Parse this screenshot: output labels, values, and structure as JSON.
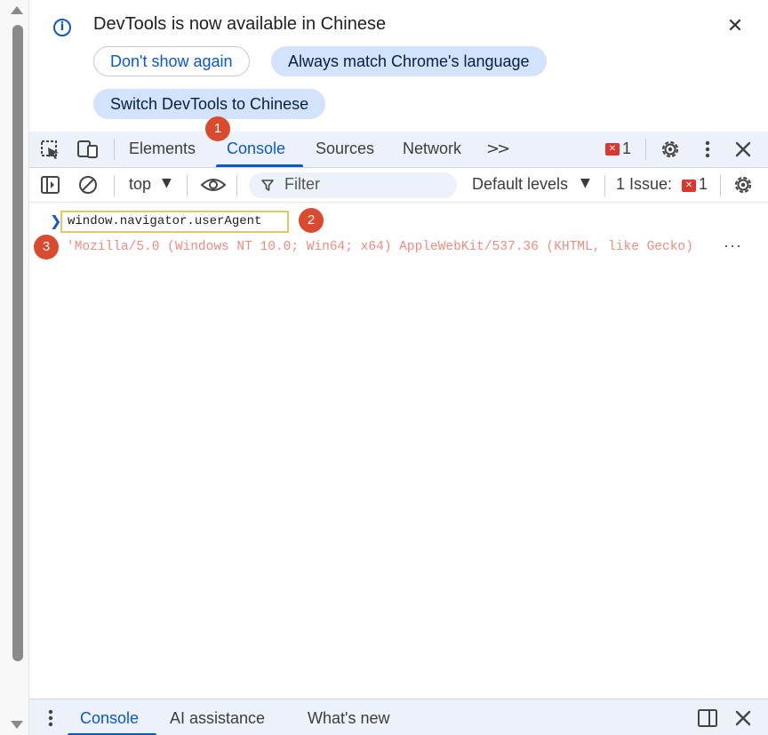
{
  "infobar": {
    "title": "DevTools is now available in Chinese",
    "dont_show_label": "Don't show again",
    "match_language_label": "Always match Chrome's language",
    "switch_label": "Switch DevTools to Chinese"
  },
  "tabs": [
    {
      "label": "Elements"
    },
    {
      "label": "Console"
    },
    {
      "label": "Sources"
    },
    {
      "label": "Network"
    }
  ],
  "more_tabs_glyph": ">>",
  "error_count": "1",
  "console_toolbar": {
    "context": "top",
    "filter_placeholder": "Filter",
    "levels": "Default levels",
    "issues_label": "1 Issue:",
    "issues_count": "1"
  },
  "console": {
    "input": "window.navigator.userAgent",
    "output": "'Mozilla/5.0 (Windows NT 10.0; Win64; x64) AppleWebKit/537.36 (KHTML, like Gecko)",
    "more": "···"
  },
  "drawer": {
    "tabs": [
      {
        "label": "Console"
      },
      {
        "label": "AI assistance"
      },
      {
        "label": "What's new"
      }
    ]
  },
  "badges": [
    "1",
    "2",
    "3"
  ],
  "colors": {
    "accent": "#0b57d0",
    "badge": "#d94a2e",
    "output_text": "#f28b82",
    "highlight_border": "#e4c66a"
  }
}
